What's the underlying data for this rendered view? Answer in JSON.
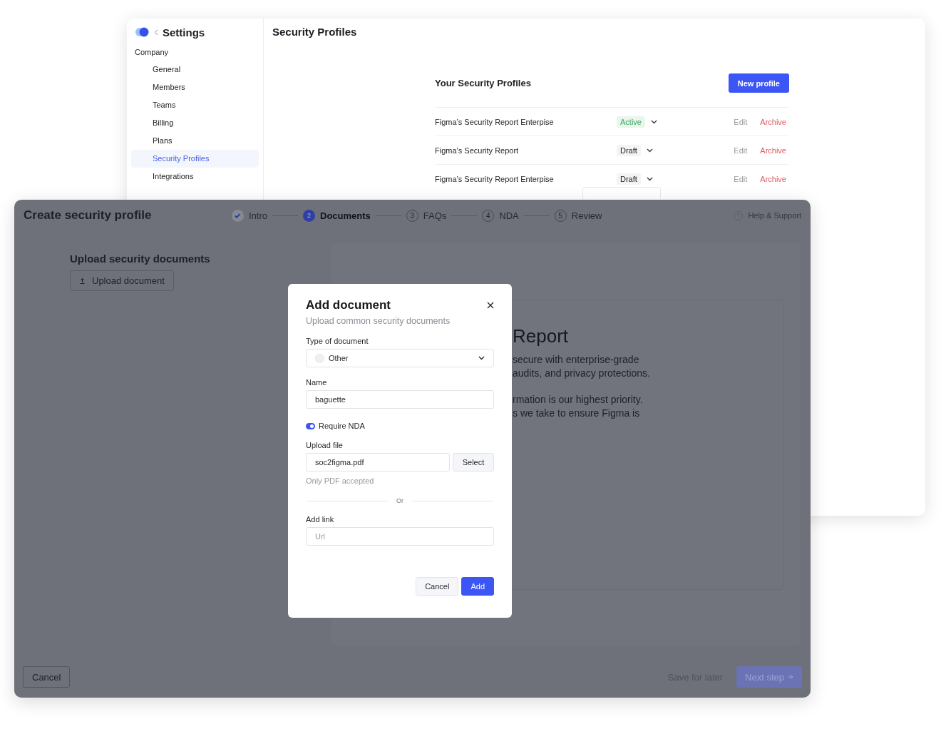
{
  "settings": {
    "title": "Settings",
    "section": "Company",
    "nav": [
      {
        "label": "General",
        "selected": false
      },
      {
        "label": "Members",
        "selected": false
      },
      {
        "label": "Teams",
        "selected": false
      },
      {
        "label": "Billing",
        "selected": false
      },
      {
        "label": "Plans",
        "selected": false
      },
      {
        "label": "Security Profiles",
        "selected": true
      },
      {
        "label": "Integrations",
        "selected": false
      }
    ],
    "page_title": "Security Profiles",
    "heading": "Your Security Profiles",
    "new_button": "New profile",
    "profiles": [
      {
        "name": "Figma’s Security Report Enterpise",
        "status": "Active",
        "kind": "active",
        "edit": "Edit",
        "archive": "Archive"
      },
      {
        "name": "Figma’s Security Report",
        "status": "Draft",
        "kind": "draft",
        "edit": "Edit",
        "archive": "Archive"
      },
      {
        "name": "Figma’s Security Report Enterpise",
        "status": "Draft",
        "kind": "draft",
        "edit": "Edit",
        "archive": "Archive"
      }
    ]
  },
  "wizard": {
    "title": "Create security profile",
    "steps": [
      {
        "label": "Intro",
        "completed": true,
        "selected": false
      },
      {
        "number": "2",
        "label": "Documents",
        "completed": false,
        "selected": true
      },
      {
        "number": "3",
        "label": "FAQs",
        "completed": false,
        "selected": false
      },
      {
        "number": "4",
        "label": "NDA",
        "completed": false,
        "selected": false
      },
      {
        "number": "5",
        "label": "Review",
        "completed": false,
        "selected": false
      }
    ],
    "help": "Help & Support",
    "section_title": "Upload security documents",
    "upload_button": "Upload document",
    "preview": {
      "title": "Report",
      "paragraphs": [
        [
          "secure with enterprise-grade",
          "audits, and privacy protections."
        ],
        [
          "rmation is our highest priority.",
          "s we take to ensure Figma is"
        ]
      ]
    },
    "cancel": "Cancel",
    "save": "Save for later",
    "next": {
      "label": "Next step",
      "disabled": true
    }
  },
  "modal": {
    "title": "Add document",
    "subtitle": "Upload common security documents",
    "type_label": "Type of document",
    "type_value": "Other",
    "name_label": "Name",
    "name_value": "baguette",
    "nda": {
      "label": "Require NDA",
      "on": true
    },
    "file_label": "Upload file",
    "file_value": "soc2figma.pdf",
    "select": "Select",
    "file_hint": "Only PDF accepted",
    "or": "Or",
    "link_label": "Add link",
    "link_placeholder": "Url",
    "cancel": "Cancel",
    "add": "Add"
  }
}
